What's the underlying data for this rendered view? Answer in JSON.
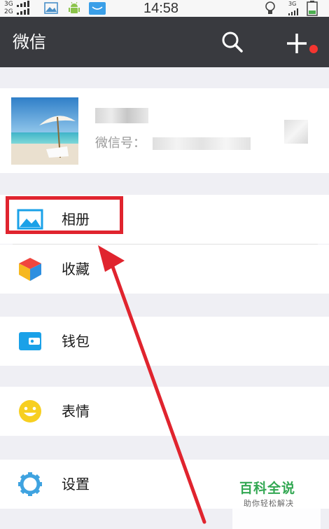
{
  "status_bar": {
    "network_top": "3G",
    "network_bottom": "2G",
    "time": "14:58",
    "network_right": "3G"
  },
  "header": {
    "title": "微信",
    "search_icon": "search-icon",
    "add_icon": "plus-icon"
  },
  "profile": {
    "wechat_id_label": "微信号："
  },
  "menu": {
    "items": [
      {
        "label": "相册",
        "icon": "album-icon",
        "color": "#1aa1e8"
      },
      {
        "label": "收藏",
        "icon": "favorites-cube-icon",
        "color": "#f0463f"
      },
      {
        "label": "钱包",
        "icon": "wallet-icon",
        "color": "#1aa1e8"
      },
      {
        "label": "表情",
        "icon": "emoji-smiley-icon",
        "color": "#f7cf20"
      },
      {
        "label": "设置",
        "icon": "gear-icon",
        "color": "#3fa3e0"
      }
    ]
  },
  "annotation": {
    "highlight_color": "#e0242e"
  },
  "watermark": {
    "title": "百科全说",
    "subtitle": "助你轻松解决"
  }
}
